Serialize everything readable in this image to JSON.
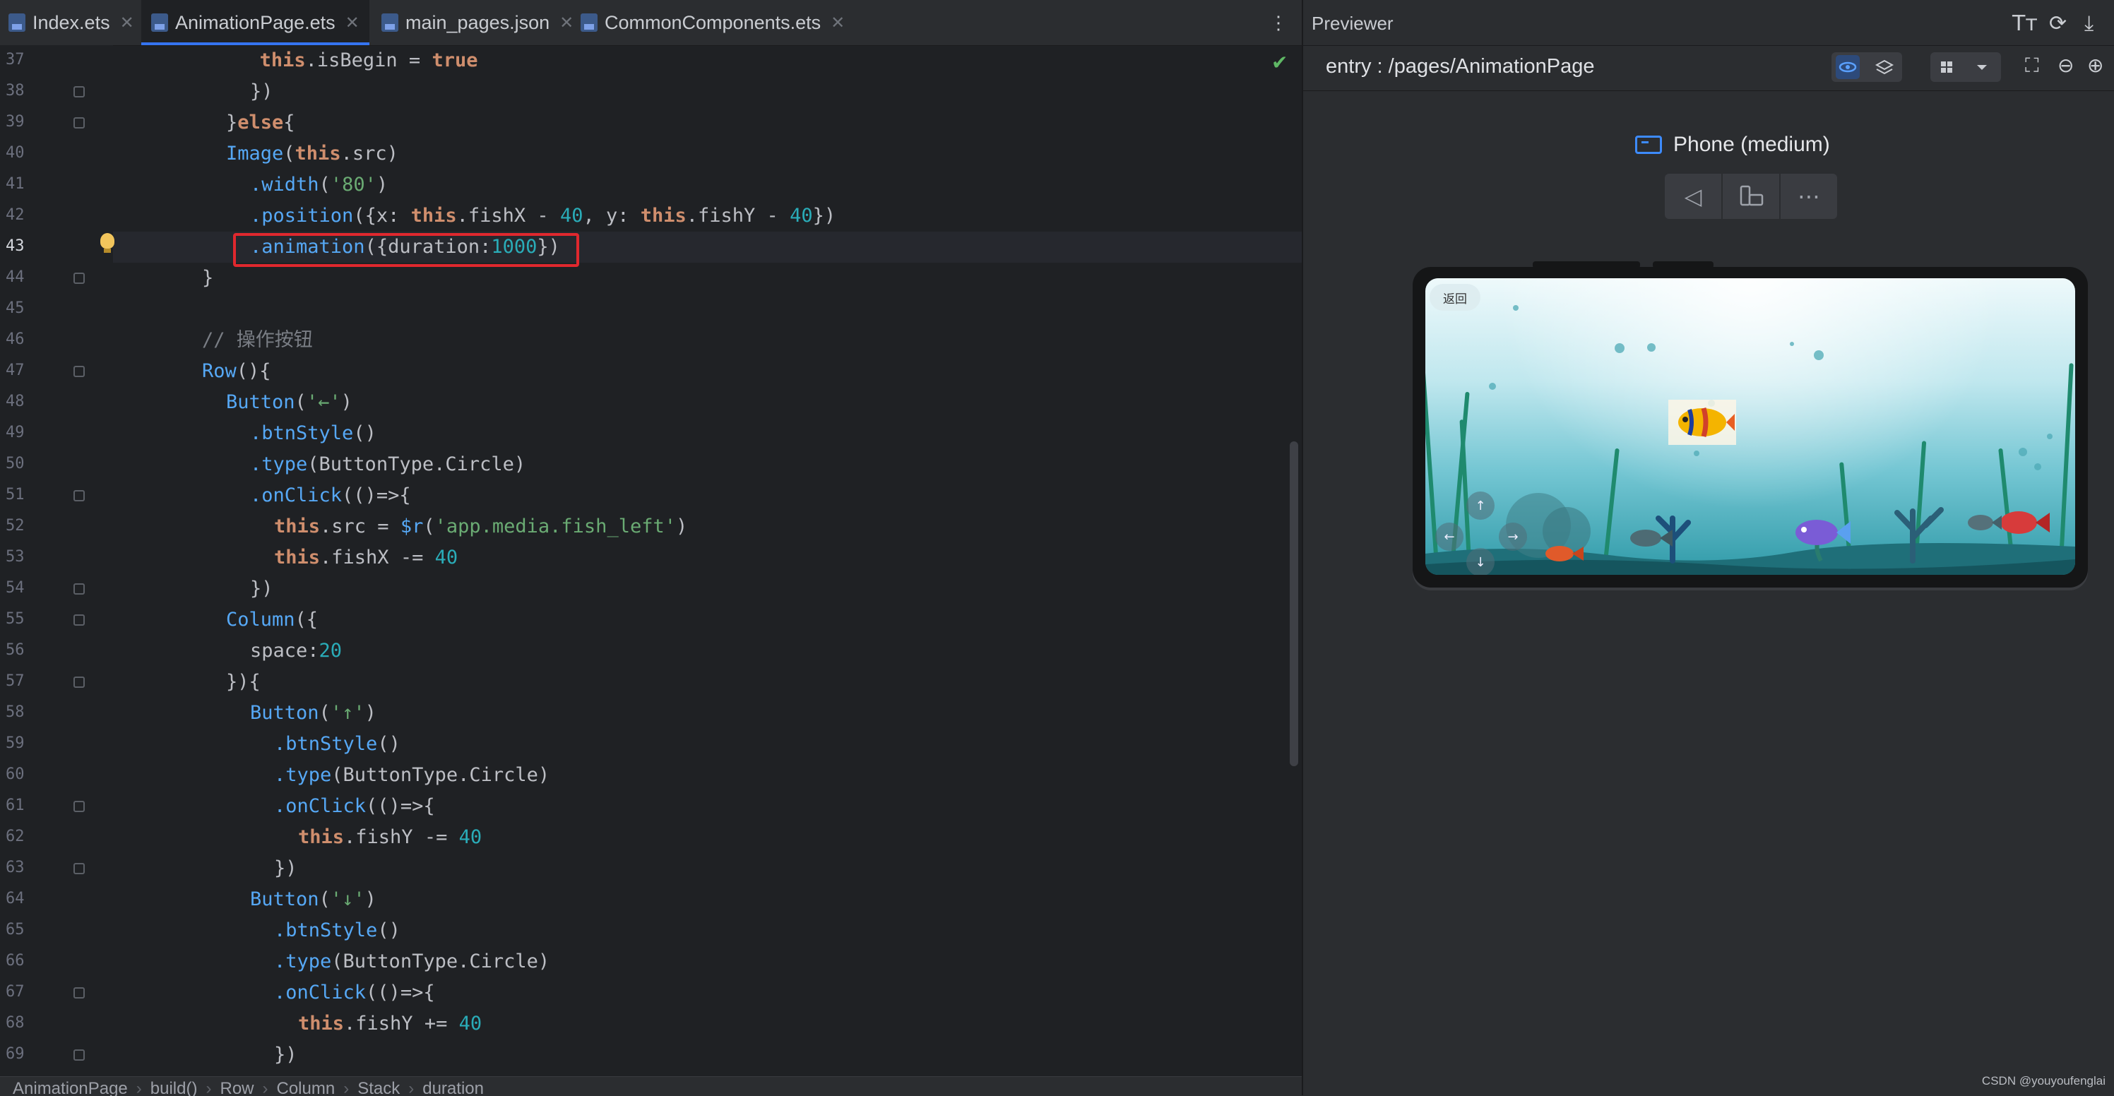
{
  "editor": {
    "tabs": [
      {
        "label": "Index.ets",
        "active": false
      },
      {
        "label": "AnimationPage.ets",
        "active": true
      },
      {
        "label": "main_pages.json",
        "active": false
      },
      {
        "label": "CommonComponents.ets",
        "active": false
      }
    ],
    "current_line": "43",
    "line_numbers": [
      "37",
      "38",
      "39",
      "40",
      "41",
      "42",
      "43",
      "44",
      "45",
      "46",
      "47",
      "48",
      "49",
      "50",
      "51",
      "52",
      "53",
      "54",
      "55",
      "56",
      "57",
      "58",
      "59",
      "60",
      "61",
      "62",
      "63",
      "64",
      "65",
      "66",
      "67",
      "68",
      "69"
    ],
    "code": {
      "l37": [
        "this",
        ".isBegin = ",
        "true"
      ],
      "l38": [
        "})"
      ],
      "l39": [
        "}",
        "else",
        "{"
      ],
      "l40": [
        "Image",
        "(",
        "this",
        ".src)"
      ],
      "l41": [
        ".width",
        "(",
        "'80'",
        ")"
      ],
      "l42": [
        ".position",
        "({x: ",
        "this",
        ".fishX - ",
        "40",
        ", y: ",
        "this",
        ".fishY - ",
        "40",
        "})"
      ],
      "l43": [
        ".animation",
        "({duration:",
        "1000",
        "})"
      ],
      "l44": [
        "}"
      ],
      "l46": [
        "// 操作按钮"
      ],
      "l47": [
        "Row",
        "(){"
      ],
      "l48": [
        "Button",
        "(",
        "'←'",
        ")"
      ],
      "l49": [
        ".btnStyle",
        "()"
      ],
      "l50": [
        ".type",
        "(ButtonType.Circle)"
      ],
      "l51": [
        ".onClick",
        "(()=>{"
      ],
      "l52": [
        "this",
        ".src = ",
        "$r",
        "(",
        "'app.media.fish_left'",
        ")"
      ],
      "l53": [
        "this",
        ".fishX -= ",
        "40"
      ],
      "l54": [
        "})"
      ],
      "l55": [
        "Column",
        "({"
      ],
      "l56": [
        "space:",
        "20"
      ],
      "l57": [
        "}){"
      ],
      "l58": [
        "Button",
        "(",
        "'↑'",
        ")"
      ],
      "l59": [
        ".btnStyle",
        "()"
      ],
      "l60": [
        ".type",
        "(ButtonType.Circle)"
      ],
      "l61": [
        ".onClick",
        "(()=>{"
      ],
      "l62": [
        "this",
        ".fishY -= ",
        "40"
      ],
      "l63": [
        "})"
      ],
      "l64": [
        "Button",
        "(",
        "'↓'",
        ")"
      ],
      "l65": [
        ".btnStyle",
        "()"
      ],
      "l66": [
        ".type",
        "(ButtonType.Circle)"
      ],
      "l67": [
        ".onClick",
        "(()=>{"
      ],
      "l68": [
        "this",
        ".fishY += ",
        "40"
      ],
      "l69": [
        "})"
      ]
    },
    "breadcrumb": [
      "AnimationPage",
      "build()",
      "Row",
      "Column",
      "Stack",
      "duration"
    ]
  },
  "previewer": {
    "title": "Previewer",
    "route": "entry : /pages/AnimationPage",
    "device_name": "Phone (medium)",
    "back_button_label": "返回",
    "accent_color": "#3d8bff",
    "highlight_color": "#e0282e"
  },
  "watermark": "CSDN @youyoufenglai"
}
